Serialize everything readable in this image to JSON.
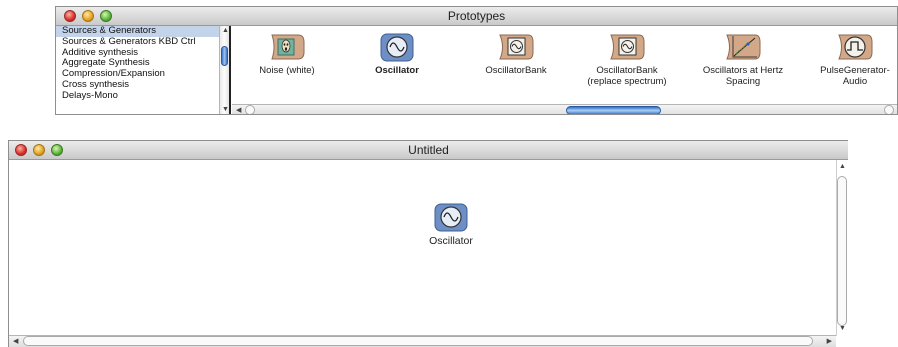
{
  "prototypes_window": {
    "title": "Prototypes",
    "categories": [
      {
        "label": "Sources & Generators",
        "selected": true
      },
      {
        "label": "Sources & Generators KBD Ctrl",
        "selected": false
      },
      {
        "label": "Additive synthesis",
        "selected": false
      },
      {
        "label": "Aggregate Synthesis",
        "selected": false
      },
      {
        "label": "Compression/Expansion",
        "selected": false
      },
      {
        "label": "Cross synthesis",
        "selected": false
      },
      {
        "label": "Delays-Mono",
        "selected": false
      }
    ],
    "prototypes": [
      {
        "label": "Noise (white)",
        "icon": "scream-icon"
      },
      {
        "label": "Oscillator",
        "icon": "sine-wave-icon"
      },
      {
        "label": "OscillatorBank",
        "icon": "oscillator-bank-icon"
      },
      {
        "label": "OscillatorBank (replace spectrum)",
        "icon": "oscillator-bank-icon"
      },
      {
        "label": "Oscillators at Hertz Spacing",
        "icon": "graph-icon"
      },
      {
        "label": "PulseGenerator-Audio",
        "icon": "pulse-icon"
      }
    ]
  },
  "untitled_window": {
    "title": "Untitled",
    "placed_item": {
      "label": "Oscillator",
      "icon": "sine-wave-icon"
    }
  },
  "colors": {
    "selection": "#c3d3ea",
    "scroll_thumb": "#3d76c9",
    "icon_tan": "#d2a889",
    "icon_blue": "#6d8fc6"
  }
}
